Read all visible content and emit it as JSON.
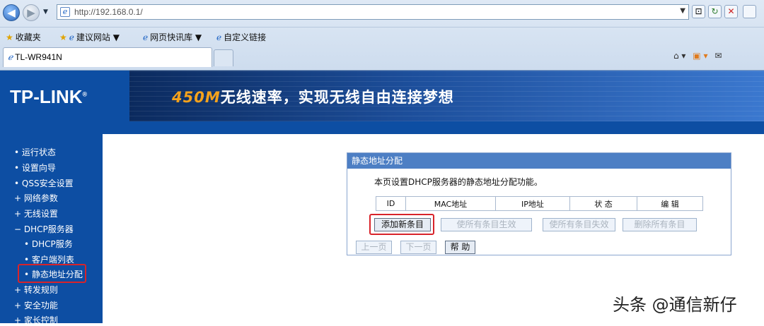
{
  "browser": {
    "address": "http://192.168.0.1/",
    "favorites": {
      "label": "收藏夹",
      "items": [
        "建议网站 ▼",
        "网页快讯库 ▼",
        "自定义链接"
      ]
    },
    "tab_title": "TL-WR941N",
    "nav_drop": "▼",
    "addr_drop": "▼"
  },
  "header": {
    "logo": "TP-LINK",
    "slogan_speed": "450M",
    "slogan_rest": "无线速率，实现无线自由连接梦想"
  },
  "sidebar": {
    "items": [
      {
        "bullet": "•",
        "label": "运行状态"
      },
      {
        "bullet": "•",
        "label": "设置向导"
      },
      {
        "bullet": "•",
        "label": "QSS安全设置"
      },
      {
        "bullet": "+",
        "label": "网络参数"
      },
      {
        "bullet": "+",
        "label": "无线设置"
      },
      {
        "bullet": "−",
        "label": "DHCP服务器"
      },
      {
        "bullet": "•",
        "label": "DHCP服务"
      },
      {
        "bullet": "•",
        "label": "客户端列表"
      },
      {
        "bullet": "•",
        "label": "静态地址分配"
      },
      {
        "bullet": "+",
        "label": "转发规则"
      },
      {
        "bullet": "+",
        "label": "安全功能"
      },
      {
        "bullet": "+",
        "label": "家长控制"
      }
    ]
  },
  "panel": {
    "title": "静态地址分配",
    "description": "本页设置DHCP服务器的静态地址分配功能。",
    "columns": [
      "ID",
      "MAC地址",
      "IP地址",
      "状 态",
      "编 辑"
    ],
    "buttons": {
      "add": "添加新条目",
      "enable_all": "使所有条目生效",
      "disable_all": "使所有条目失效",
      "delete_all": "删除所有条目"
    },
    "pager": {
      "prev": "上一页",
      "next": "下一页",
      "help": "帮 助"
    }
  },
  "watermark": "头条 @通信新仔",
  "colors": {
    "brand_blue": "#0d4ea3",
    "panel_title": "#4d7fc4",
    "highlight_red": "#d8232a",
    "speed_orange": "#f5a21c"
  }
}
